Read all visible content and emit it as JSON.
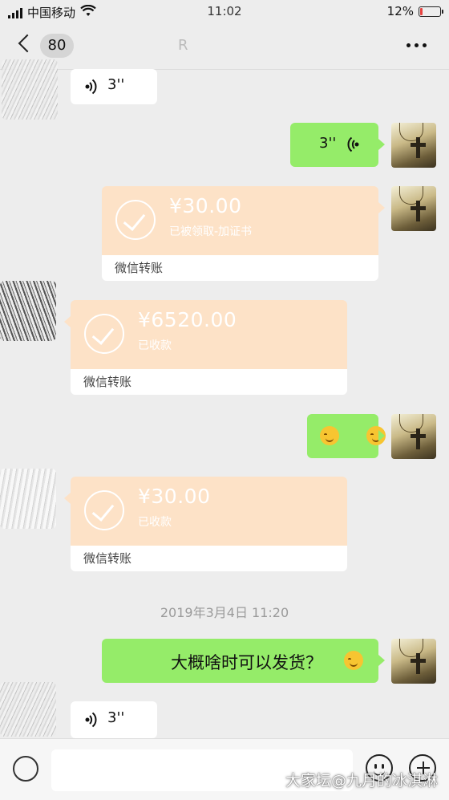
{
  "status_bar": {
    "carrier": "中国移动",
    "time": "11:02",
    "battery_percent": "12%",
    "battery_level": 0.12,
    "battery_color": "#e64340"
  },
  "nav": {
    "back_icon": "chevron-left-icon",
    "unread_count": "80",
    "title": "R",
    "more_icon": "more-dots-icon"
  },
  "messages": [
    {
      "id": "m1",
      "side": "left",
      "type": "voice",
      "duration": "3''"
    },
    {
      "id": "m2",
      "side": "right",
      "type": "voice",
      "duration": "3''"
    },
    {
      "id": "m3",
      "side": "right",
      "type": "transfer",
      "amount": "¥30.00",
      "status": "已被领取-加证书",
      "footer": "微信转账"
    },
    {
      "id": "m4",
      "side": "left",
      "type": "transfer",
      "amount": "¥6520.00",
      "status": "已收款",
      "footer": "微信转账"
    },
    {
      "id": "m5",
      "side": "right",
      "type": "emoji",
      "emojis": [
        "smile-emoji",
        "smile-emoji"
      ]
    },
    {
      "id": "m6",
      "side": "left",
      "type": "transfer",
      "amount": "¥30.00",
      "status": "已收款",
      "footer": "微信转账"
    },
    {
      "id": "m7",
      "side": "right",
      "type": "text",
      "text": "大概啥时可以发货？",
      "emoji": "smile-emoji"
    },
    {
      "id": "m8",
      "side": "left",
      "type": "voice",
      "duration": "3''"
    }
  ],
  "timestamp": "2019年3月4日 11:20",
  "input_bar": {
    "voice_icon": "voice-mode-icon",
    "emoji_icon": "emoji-icon",
    "plus_icon": "plus-icon"
  },
  "watermark": "大家坛@九月的冰淇淋",
  "colors": {
    "background": "#ededed",
    "sent_bubble": "#95ec69",
    "received_bubble": "#ffffff",
    "transfer_card": "#fde2c7"
  }
}
